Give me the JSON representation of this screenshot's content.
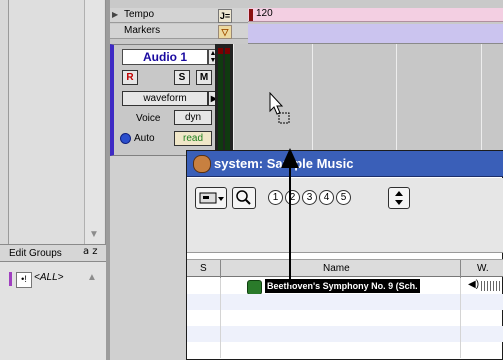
{
  "rulers": [
    {
      "label": "Tempo",
      "badge": "J="
    },
    {
      "label": "Markers",
      "badge": "▽"
    }
  ],
  "tempo_value": "120",
  "track": {
    "name": "Audio 1",
    "record_label": "R",
    "solo_label": "S",
    "mute_label": "M",
    "view_label": "waveform",
    "voice_label": "Voice",
    "voice_value": "dyn",
    "auto_label": "Auto",
    "auto_value": "read"
  },
  "edit_groups": {
    "title": "Edit Groups",
    "sort_glyph": "a z",
    "row_toggle": "•!",
    "row_label": "<ALL>"
  },
  "workspace": {
    "title": "system: Sample Music",
    "number_buttons": [
      "1",
      "2",
      "3",
      "4",
      "5"
    ],
    "columns": [
      "S",
      "Name",
      "W."
    ],
    "file_name": "Beethoven's Symphony No. 9 (Sch."
  },
  "colors": {
    "track_accent": "#3e2ac4",
    "title_bar": "#3a5fb8",
    "tempo_lane": "#f3cfe2",
    "markers_lane": "#cbc4ef"
  }
}
